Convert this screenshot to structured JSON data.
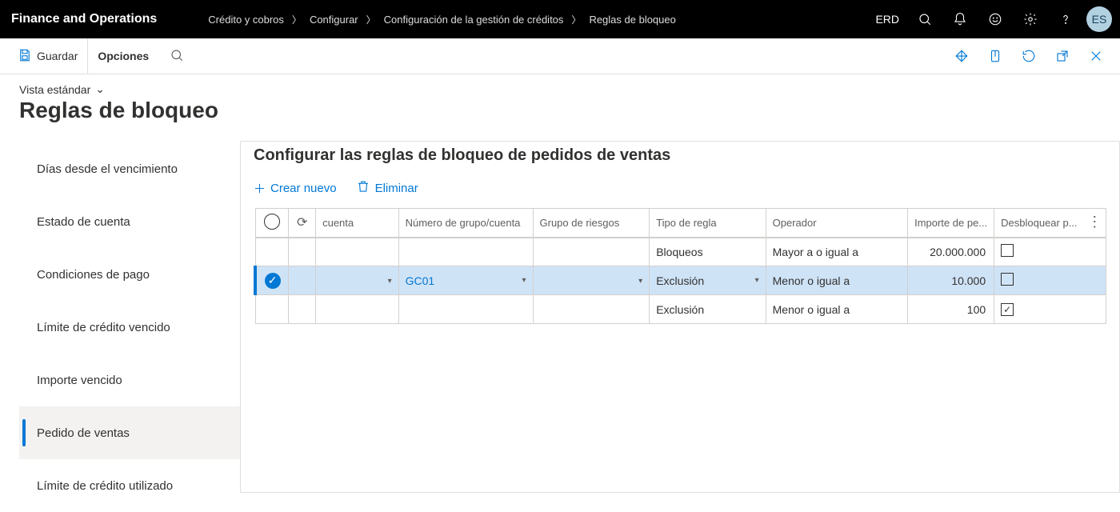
{
  "app": {
    "title": "Finance and Operations",
    "company": "ERD",
    "avatar": "ES"
  },
  "breadcrumbs": [
    "Crédito y cobros",
    "Configurar",
    "Configuración de la gestión de créditos",
    "Reglas de bloqueo"
  ],
  "actionbar": {
    "save": "Guardar",
    "options": "Opciones",
    "search_placeholder": ""
  },
  "page": {
    "view": "Vista estándar",
    "title": "Reglas de bloqueo"
  },
  "leftnav": {
    "items": [
      "Días desde el vencimiento",
      "Estado de cuenta",
      "Condiciones de pago",
      "Límite de crédito vencido",
      "Importe vencido",
      "Pedido de ventas",
      "Límite de crédito utilizado"
    ],
    "selected_index": 5
  },
  "panel": {
    "title": "Configurar las reglas de bloqueo de pedidos de ventas",
    "actions": {
      "new": "Crear nuevo",
      "delete": "Eliminar"
    },
    "columns": {
      "account": "cuenta",
      "group": "Número de grupo/cuenta",
      "risk": "Grupo de riesgos",
      "ruletype": "Tipo de regla",
      "operator": "Operador",
      "amount": "Importe de pe...",
      "unlock": "Desbloquear p..."
    },
    "rows": [
      {
        "selected": false,
        "account": "",
        "group": "",
        "risk": "",
        "ruletype": "Bloqueos",
        "operator": "Mayor a o igual a",
        "amount": "20.000.000",
        "unlock": false
      },
      {
        "selected": true,
        "account": "",
        "group": "GC01",
        "risk": "",
        "ruletype": "Exclusión",
        "operator": "Menor o igual a",
        "amount": "10.000",
        "unlock": false
      },
      {
        "selected": false,
        "account": "",
        "group": "",
        "risk": "",
        "ruletype": "Exclusión",
        "operator": "Menor o igual a",
        "amount": "100",
        "unlock": true
      }
    ]
  }
}
